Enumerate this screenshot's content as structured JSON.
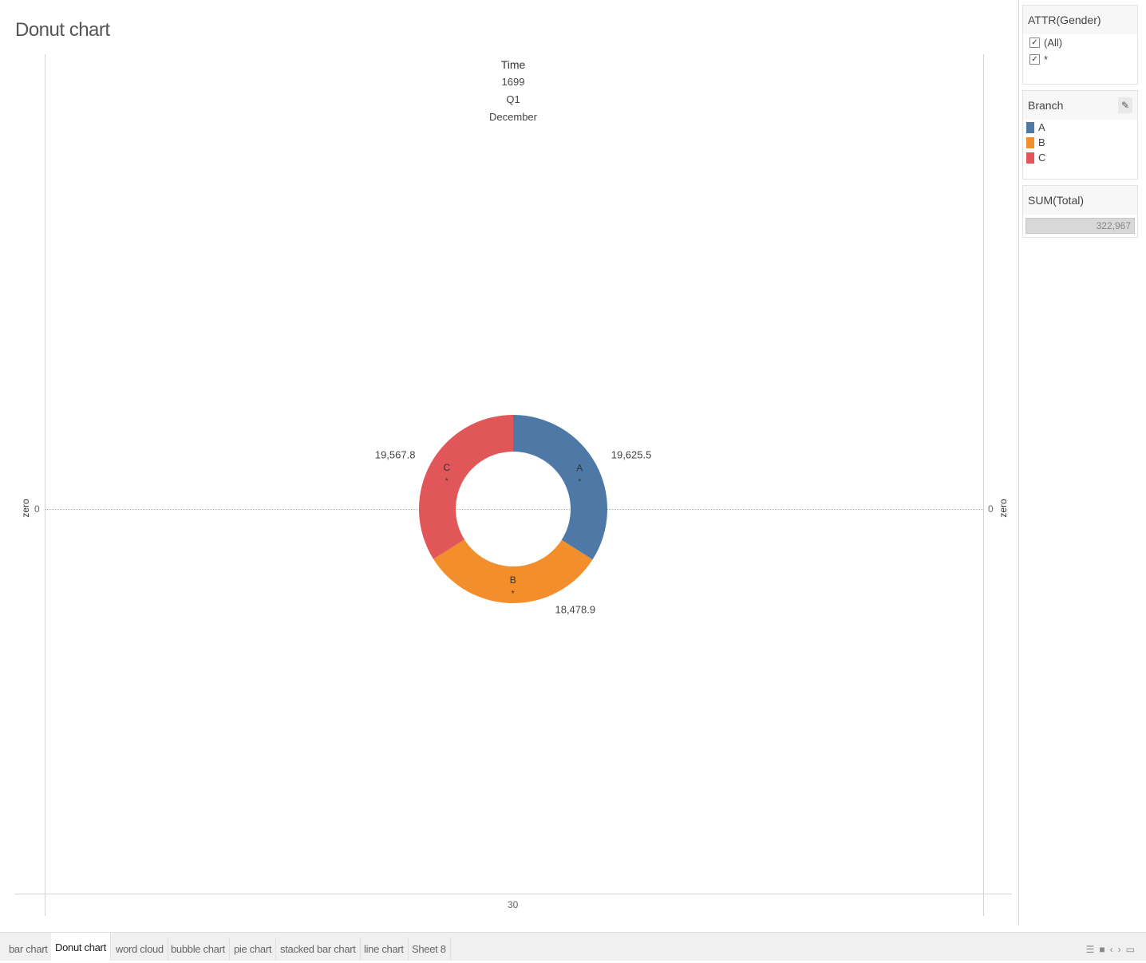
{
  "sheet_title": "Donut chart",
  "header": {
    "title": "Time",
    "lines": [
      "1699",
      "Q1",
      "December"
    ]
  },
  "axes": {
    "left_title": "zero",
    "left_tick": "0",
    "right_title": "zero",
    "right_tick": "0",
    "bottom_tick": "30"
  },
  "chart_data": {
    "type": "pie",
    "donut": true,
    "slices": [
      {
        "label": "A",
        "value": 19625.5,
        "display": "19,625.5",
        "color": "#4e79a7"
      },
      {
        "label": "B",
        "value": 18478.9,
        "display": "18,478.9",
        "color": "#f28e2b"
      },
      {
        "label": "C",
        "value": 19567.8,
        "display": "19,567.8",
        "color": "#e15759"
      }
    ]
  },
  "filter": {
    "title": "ATTR(Gender)",
    "options": [
      {
        "label": "(All)",
        "checked": true
      },
      {
        "label": "*",
        "checked": true
      }
    ]
  },
  "legend": {
    "title": "Branch",
    "items": [
      {
        "label": "A",
        "color": "#4e79a7"
      },
      {
        "label": "B",
        "color": "#f28e2b"
      },
      {
        "label": "C",
        "color": "#e15759"
      }
    ]
  },
  "size_legend": {
    "title": "SUM(Total)",
    "value": "322,967"
  },
  "tabs": [
    "bar chart",
    "Donut chart",
    "word cloud",
    "bubble chart",
    "pie chart",
    "stacked bar chart",
    "line chart",
    "Sheet 8"
  ],
  "active_tab": "Donut chart",
  "colors": {
    "accent_active_tab": "#ffffff",
    "gridline": "#d4d4d4"
  }
}
